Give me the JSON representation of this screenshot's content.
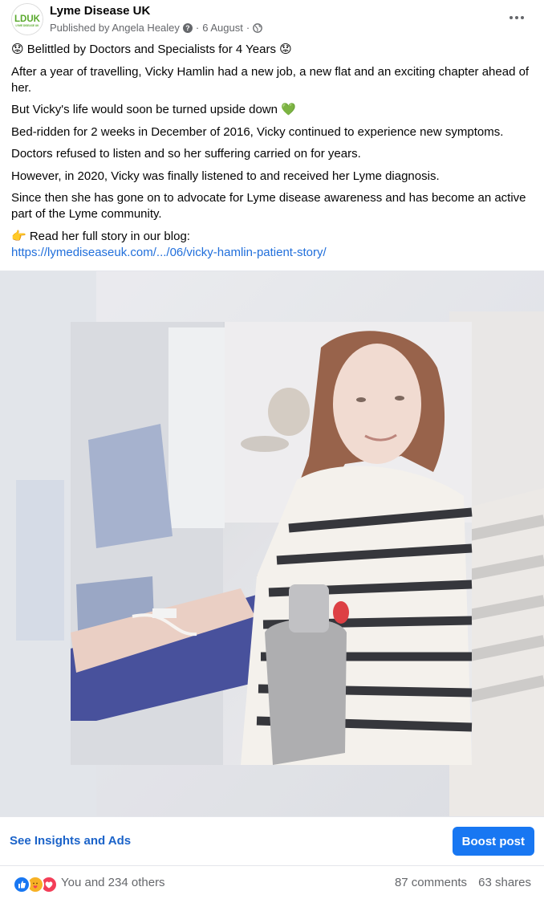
{
  "post": {
    "page_name": "Lyme Disease UK",
    "avatar_text": "LDUK",
    "avatar_subtext": "LYME DISEASE UK",
    "published_by": "Published by Angela Healey",
    "date": "6 August",
    "separator": "·",
    "more_icon": "more-horizontal-icon",
    "privacy_icon": "globe-icon",
    "help_icon": "question-icon"
  },
  "body": {
    "headline": "😟 Belittled by Doctors and Specialists for 4 Years 😟",
    "paragraphs": [
      "After a year of travelling, Vicky Hamlin had a new job, a new flat and an exciting chapter ahead of her.",
      "But Vicky's life would soon be turned upside down 💚",
      "Bed-ridden for 2 weeks in December of 2016, Vicky continued to experience new symptoms.",
      "Doctors refused to listen and so her suffering carried on for years.",
      "However, in 2020, Vicky was finally listened to and received her Lyme diagnosis.",
      "Since then she has gone on to advocate for Lyme disease awareness and has become an active part of the Lyme community."
    ],
    "cta": "👉 Read her full story in our blog:",
    "link": "https://lymediseaseuk.com/.../06/vicky-hamlin-patient-story/"
  },
  "actions": {
    "insights_label": "See Insights and Ads",
    "boost_label": "Boost post",
    "accent_color": "#1877f2"
  },
  "engagement": {
    "reactions_text": "You and 234 others",
    "comments_text": "87 comments",
    "shares_text": "63 shares",
    "reaction_icons": [
      "like-icon",
      "care-icon",
      "love-icon"
    ]
  }
}
